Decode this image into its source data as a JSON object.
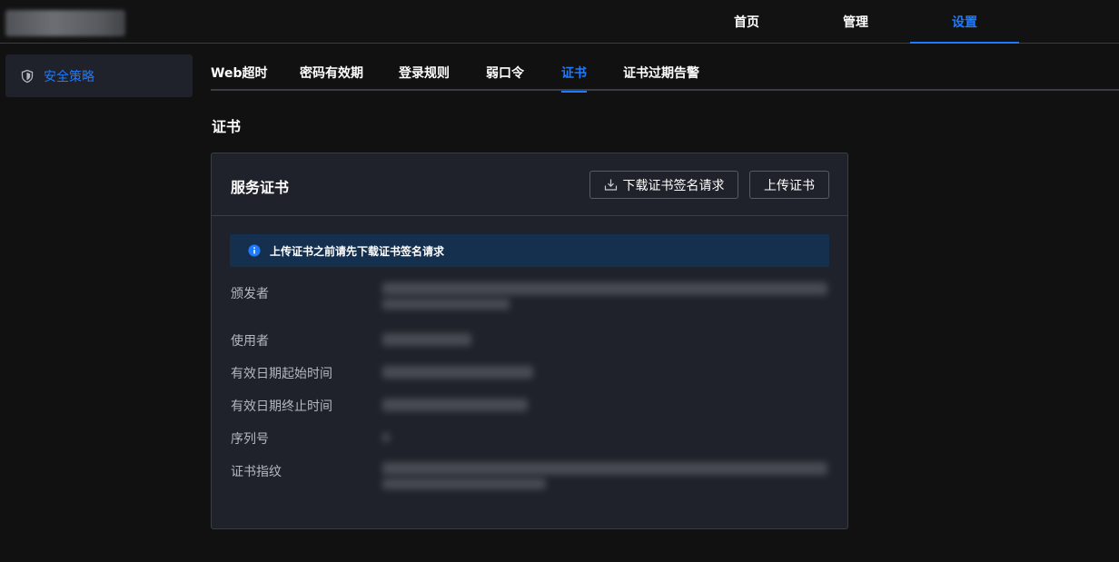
{
  "topnav": {
    "items": [
      {
        "label": "首页",
        "active": false
      },
      {
        "label": "管理",
        "active": false
      },
      {
        "label": "设置",
        "active": true
      }
    ]
  },
  "sidebar": {
    "items": [
      {
        "label": "安全策略",
        "icon": "shield-icon",
        "active": true
      }
    ]
  },
  "tabs": [
    {
      "label": "Web超时",
      "active": false
    },
    {
      "label": "密码有效期",
      "active": false
    },
    {
      "label": "登录规则",
      "active": false
    },
    {
      "label": "弱口令",
      "active": false
    },
    {
      "label": "证书",
      "active": true
    },
    {
      "label": "证书过期告警",
      "active": false
    }
  ],
  "section_title": "证书",
  "card": {
    "title": "服务证书",
    "download_button": "下载证书签名请求",
    "upload_button": "上传证书",
    "alert": "上传证书之前请先下载证书签名请求",
    "fields": [
      {
        "label": "颁发者"
      },
      {
        "label": "使用者"
      },
      {
        "label": "有效日期起始时间"
      },
      {
        "label": "有效日期终止时间"
      },
      {
        "label": "序列号"
      },
      {
        "label": "证书指纹"
      }
    ]
  },
  "colors": {
    "accent": "#1e7bff",
    "background": "#111111",
    "panel": "#1f222a",
    "alert_bg": "#15304e"
  }
}
